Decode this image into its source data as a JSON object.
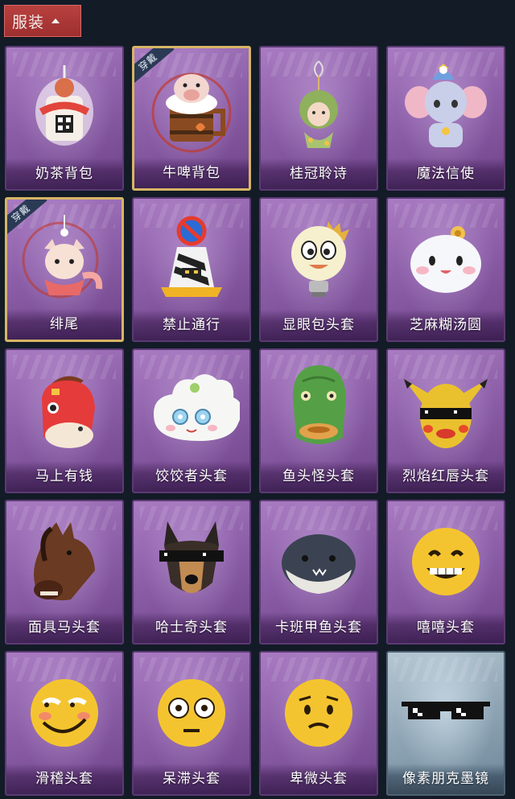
{
  "header": {
    "tab_label": "服装"
  },
  "equipped_badge": "穿戴",
  "items": [
    {
      "name": "奶茶背包",
      "icon": "milk-tea-bag-icon",
      "equipped": false,
      "frame": "purple"
    },
    {
      "name": "牛啤背包",
      "icon": "cow-beer-bag-icon",
      "equipped": true,
      "frame": "purple"
    },
    {
      "name": "桂冠聆诗",
      "icon": "laurel-charm-icon",
      "equipped": false,
      "frame": "purple"
    },
    {
      "name": "魔法信使",
      "icon": "magic-elephant-icon",
      "equipped": false,
      "frame": "purple"
    },
    {
      "name": "绯尾",
      "icon": "fox-charm-icon",
      "equipped": true,
      "frame": "purple"
    },
    {
      "name": "禁止通行",
      "icon": "no-entry-cone-icon",
      "equipped": false,
      "frame": "purple"
    },
    {
      "name": "显眼包头套",
      "icon": "lightbulb-head-icon",
      "equipped": false,
      "frame": "purple"
    },
    {
      "name": "芝麻糊汤圆",
      "icon": "tangyuan-head-icon",
      "equipped": false,
      "frame": "purple"
    },
    {
      "name": "马上有钱",
      "icon": "red-horse-head-icon",
      "equipped": false,
      "frame": "purple"
    },
    {
      "name": "饺饺者头套",
      "icon": "dumpling-head-icon",
      "equipped": false,
      "frame": "purple"
    },
    {
      "name": "鱼头怪头套",
      "icon": "fish-head-icon",
      "equipped": false,
      "frame": "purple"
    },
    {
      "name": "烈焰红唇头套",
      "icon": "yellow-mouse-head-icon",
      "equipped": false,
      "frame": "purple"
    },
    {
      "name": "面具马头套",
      "icon": "horse-mask-icon",
      "equipped": false,
      "frame": "purple"
    },
    {
      "name": "哈士奇头套",
      "icon": "husky-head-icon",
      "equipped": false,
      "frame": "purple"
    },
    {
      "name": "卡班甲鱼头套",
      "icon": "whale-head-icon",
      "equipped": false,
      "frame": "purple"
    },
    {
      "name": "嘻嘻头套",
      "icon": "grin-emoji-icon",
      "equipped": false,
      "frame": "purple"
    },
    {
      "name": "滑稽头套",
      "icon": "funny-emoji-icon",
      "equipped": false,
      "frame": "purple"
    },
    {
      "name": "呆滞头套",
      "icon": "dazed-emoji-icon",
      "equipped": false,
      "frame": "purple"
    },
    {
      "name": "卑微头套",
      "icon": "humble-emoji-icon",
      "equipped": false,
      "frame": "purple"
    },
    {
      "name": "像素朋克墨镜",
      "icon": "pixel-sunglasses-icon",
      "equipped": false,
      "frame": "blue"
    }
  ]
}
